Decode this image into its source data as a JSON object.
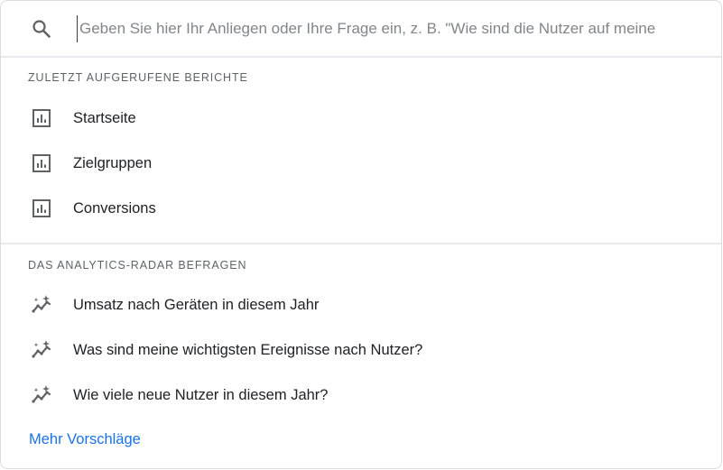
{
  "search": {
    "placeholder": "Geben Sie hier Ihr Anliegen oder Ihre Frage ein, z. B. \"Wie sind die Nutzer auf meine",
    "icon": "search-icon"
  },
  "recent": {
    "heading": "ZULETZT AUFGERUFENE BERICHTE",
    "items": [
      {
        "label": "Startseite",
        "icon": "report-icon"
      },
      {
        "label": "Zielgruppen",
        "icon": "report-icon"
      },
      {
        "label": "Conversions",
        "icon": "report-icon"
      }
    ]
  },
  "radar": {
    "heading": "DAS ANALYTICS-RADAR BEFRAGEN",
    "items": [
      {
        "label": "Umsatz nach Geräten in diesem Jahr",
        "icon": "insights-icon"
      },
      {
        "label": "Was sind meine wichtigsten Ereignisse nach Nutzer?",
        "icon": "insights-icon"
      },
      {
        "label": "Wie viele neue Nutzer in diesem Jahr?",
        "icon": "insights-icon"
      }
    ]
  },
  "more_link": "Mehr Vorschläge",
  "colors": {
    "accent": "#1a73e8",
    "text": "#202124",
    "muted": "#5f6368",
    "icon": "#5f6368",
    "divider": "#e8eaed"
  }
}
